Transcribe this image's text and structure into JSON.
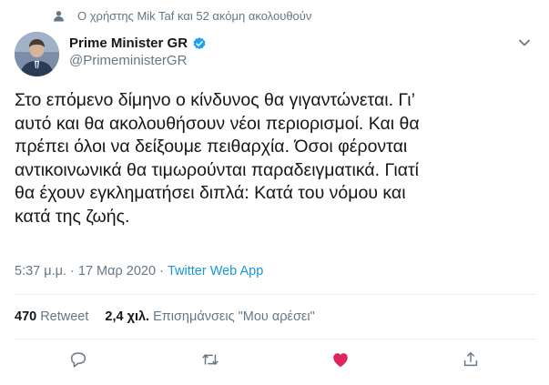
{
  "social_context": {
    "text": "Ο χρήστης Mik Taf και 52 ακόμη ακολουθούν",
    "icon": "person-icon"
  },
  "author": {
    "name": "Prime Minister GR",
    "handle": "@PrimeministerGR",
    "verified_icon": "verified-badge-icon"
  },
  "tweet": {
    "text": "Στο επόμενο δίμηνο ο κίνδυνος θα γιγαντώνεται. Γι’\nαυτό και θα ακολουθήσουν νέοι περιορισμοί. Και θα\nπρέπει όλοι να δείξουμε πειθαρχία. Όσοι φέρονται\nαντικοινωνικά θα τιμωρούνται παραδειγματικά. Γιατί\nθα έχουν εγκληματήσει διπλά: Κατά του νόμου και\nκατά της ζωής."
  },
  "meta": {
    "timestamp": "5:37 μ.μ. · 17 Μαρ 2020",
    "separator": "·",
    "source": "Twitter Web App"
  },
  "stats": {
    "retweets_count": "470",
    "retweets_label": "Retweet",
    "likes_count": "2,4 χιλ.",
    "likes_label": "Επισημάνσεις \"Μου αρέσει\""
  },
  "actions": [
    "reply-icon",
    "retweet-icon",
    "like-icon",
    "share-icon"
  ],
  "colors": {
    "text": "#14171a",
    "muted": "#657786",
    "link": "#1b95e0",
    "like": "#e0245e",
    "border": "#e6ecf0"
  }
}
